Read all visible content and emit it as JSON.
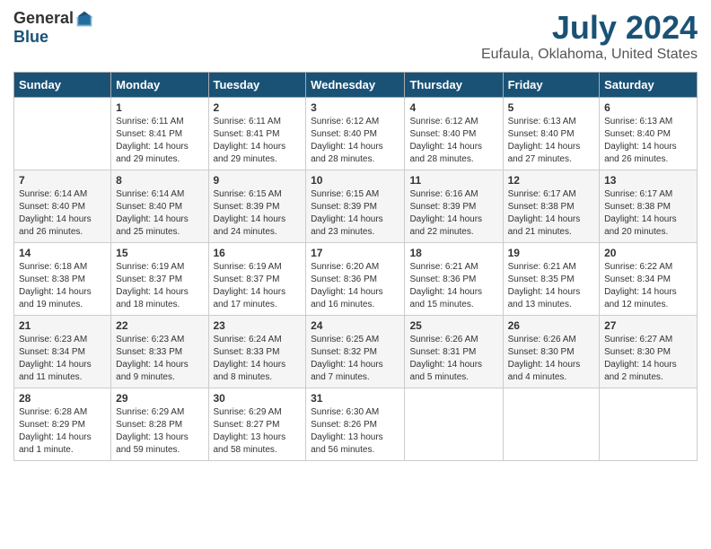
{
  "logo": {
    "general": "General",
    "blue": "Blue"
  },
  "title": "July 2024",
  "subtitle": "Eufaula, Oklahoma, United States",
  "days_of_week": [
    "Sunday",
    "Monday",
    "Tuesday",
    "Wednesday",
    "Thursday",
    "Friday",
    "Saturday"
  ],
  "weeks": [
    [
      {
        "day": "",
        "sunrise": "",
        "sunset": "",
        "daylight": ""
      },
      {
        "day": "1",
        "sunrise": "Sunrise: 6:11 AM",
        "sunset": "Sunset: 8:41 PM",
        "daylight": "Daylight: 14 hours and 29 minutes."
      },
      {
        "day": "2",
        "sunrise": "Sunrise: 6:11 AM",
        "sunset": "Sunset: 8:41 PM",
        "daylight": "Daylight: 14 hours and 29 minutes."
      },
      {
        "day": "3",
        "sunrise": "Sunrise: 6:12 AM",
        "sunset": "Sunset: 8:40 PM",
        "daylight": "Daylight: 14 hours and 28 minutes."
      },
      {
        "day": "4",
        "sunrise": "Sunrise: 6:12 AM",
        "sunset": "Sunset: 8:40 PM",
        "daylight": "Daylight: 14 hours and 28 minutes."
      },
      {
        "day": "5",
        "sunrise": "Sunrise: 6:13 AM",
        "sunset": "Sunset: 8:40 PM",
        "daylight": "Daylight: 14 hours and 27 minutes."
      },
      {
        "day": "6",
        "sunrise": "Sunrise: 6:13 AM",
        "sunset": "Sunset: 8:40 PM",
        "daylight": "Daylight: 14 hours and 26 minutes."
      }
    ],
    [
      {
        "day": "7",
        "sunrise": "Sunrise: 6:14 AM",
        "sunset": "Sunset: 8:40 PM",
        "daylight": "Daylight: 14 hours and 26 minutes."
      },
      {
        "day": "8",
        "sunrise": "Sunrise: 6:14 AM",
        "sunset": "Sunset: 8:40 PM",
        "daylight": "Daylight: 14 hours and 25 minutes."
      },
      {
        "day": "9",
        "sunrise": "Sunrise: 6:15 AM",
        "sunset": "Sunset: 8:39 PM",
        "daylight": "Daylight: 14 hours and 24 minutes."
      },
      {
        "day": "10",
        "sunrise": "Sunrise: 6:15 AM",
        "sunset": "Sunset: 8:39 PM",
        "daylight": "Daylight: 14 hours and 23 minutes."
      },
      {
        "day": "11",
        "sunrise": "Sunrise: 6:16 AM",
        "sunset": "Sunset: 8:39 PM",
        "daylight": "Daylight: 14 hours and 22 minutes."
      },
      {
        "day": "12",
        "sunrise": "Sunrise: 6:17 AM",
        "sunset": "Sunset: 8:38 PM",
        "daylight": "Daylight: 14 hours and 21 minutes."
      },
      {
        "day": "13",
        "sunrise": "Sunrise: 6:17 AM",
        "sunset": "Sunset: 8:38 PM",
        "daylight": "Daylight: 14 hours and 20 minutes."
      }
    ],
    [
      {
        "day": "14",
        "sunrise": "Sunrise: 6:18 AM",
        "sunset": "Sunset: 8:38 PM",
        "daylight": "Daylight: 14 hours and 19 minutes."
      },
      {
        "day": "15",
        "sunrise": "Sunrise: 6:19 AM",
        "sunset": "Sunset: 8:37 PM",
        "daylight": "Daylight: 14 hours and 18 minutes."
      },
      {
        "day": "16",
        "sunrise": "Sunrise: 6:19 AM",
        "sunset": "Sunset: 8:37 PM",
        "daylight": "Daylight: 14 hours and 17 minutes."
      },
      {
        "day": "17",
        "sunrise": "Sunrise: 6:20 AM",
        "sunset": "Sunset: 8:36 PM",
        "daylight": "Daylight: 14 hours and 16 minutes."
      },
      {
        "day": "18",
        "sunrise": "Sunrise: 6:21 AM",
        "sunset": "Sunset: 8:36 PM",
        "daylight": "Daylight: 14 hours and 15 minutes."
      },
      {
        "day": "19",
        "sunrise": "Sunrise: 6:21 AM",
        "sunset": "Sunset: 8:35 PM",
        "daylight": "Daylight: 14 hours and 13 minutes."
      },
      {
        "day": "20",
        "sunrise": "Sunrise: 6:22 AM",
        "sunset": "Sunset: 8:34 PM",
        "daylight": "Daylight: 14 hours and 12 minutes."
      }
    ],
    [
      {
        "day": "21",
        "sunrise": "Sunrise: 6:23 AM",
        "sunset": "Sunset: 8:34 PM",
        "daylight": "Daylight: 14 hours and 11 minutes."
      },
      {
        "day": "22",
        "sunrise": "Sunrise: 6:23 AM",
        "sunset": "Sunset: 8:33 PM",
        "daylight": "Daylight: 14 hours and 9 minutes."
      },
      {
        "day": "23",
        "sunrise": "Sunrise: 6:24 AM",
        "sunset": "Sunset: 8:33 PM",
        "daylight": "Daylight: 14 hours and 8 minutes."
      },
      {
        "day": "24",
        "sunrise": "Sunrise: 6:25 AM",
        "sunset": "Sunset: 8:32 PM",
        "daylight": "Daylight: 14 hours and 7 minutes."
      },
      {
        "day": "25",
        "sunrise": "Sunrise: 6:26 AM",
        "sunset": "Sunset: 8:31 PM",
        "daylight": "Daylight: 14 hours and 5 minutes."
      },
      {
        "day": "26",
        "sunrise": "Sunrise: 6:26 AM",
        "sunset": "Sunset: 8:30 PM",
        "daylight": "Daylight: 14 hours and 4 minutes."
      },
      {
        "day": "27",
        "sunrise": "Sunrise: 6:27 AM",
        "sunset": "Sunset: 8:30 PM",
        "daylight": "Daylight: 14 hours and 2 minutes."
      }
    ],
    [
      {
        "day": "28",
        "sunrise": "Sunrise: 6:28 AM",
        "sunset": "Sunset: 8:29 PM",
        "daylight": "Daylight: 14 hours and 1 minute."
      },
      {
        "day": "29",
        "sunrise": "Sunrise: 6:29 AM",
        "sunset": "Sunset: 8:28 PM",
        "daylight": "Daylight: 13 hours and 59 minutes."
      },
      {
        "day": "30",
        "sunrise": "Sunrise: 6:29 AM",
        "sunset": "Sunset: 8:27 PM",
        "daylight": "Daylight: 13 hours and 58 minutes."
      },
      {
        "day": "31",
        "sunrise": "Sunrise: 6:30 AM",
        "sunset": "Sunset: 8:26 PM",
        "daylight": "Daylight: 13 hours and 56 minutes."
      },
      {
        "day": "",
        "sunrise": "",
        "sunset": "",
        "daylight": ""
      },
      {
        "day": "",
        "sunrise": "",
        "sunset": "",
        "daylight": ""
      },
      {
        "day": "",
        "sunrise": "",
        "sunset": "",
        "daylight": ""
      }
    ]
  ]
}
